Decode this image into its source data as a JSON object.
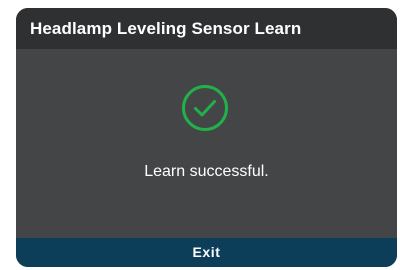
{
  "dialog": {
    "title": "Headlamp Leveling Sensor Learn",
    "icon": "check-circle-icon",
    "message": "Learn successful.",
    "exit_label": "Exit"
  },
  "colors": {
    "title_bar_background": "#2f3031",
    "body_background": "#444546",
    "success_green": "#22b04a",
    "exit_button_background": "#0c3e5a",
    "text": "#ffffff"
  }
}
